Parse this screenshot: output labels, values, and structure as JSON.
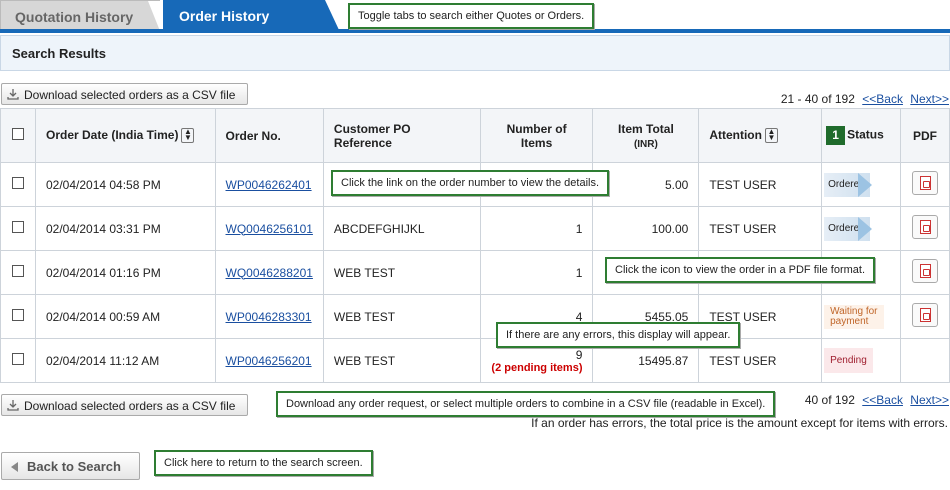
{
  "tabs": {
    "quotation": "Quotation History",
    "order": "Order History"
  },
  "callouts": {
    "tabs": "Toggle tabs to search either Quotes or Orders.",
    "order_link": "Click the link on the order number to view the details.",
    "pdf": "Click the icon to view the order in a PDF file format.",
    "errors": "If there are any errors, this display will appear.",
    "csv": "Download any order request, or select multiple orders to combine in a CSV file (readable in Excel).",
    "back": "Click here to return to the search screen."
  },
  "results_header": "Search Results",
  "csv_button": "Download selected orders as a CSV file",
  "pager": {
    "range": "21 - 40 of 192",
    "back": "<<Back",
    "next": "Next>>",
    "range_bottom": "40 of 192"
  },
  "table": {
    "headers": {
      "order_date": "Order Date (India Time)",
      "order_no": "Order No.",
      "customer_po_1": "Customer PO",
      "customer_po_2": "Reference",
      "items_1": "Number of",
      "items_2": "Items",
      "total_1": "Item Total",
      "total_2": "(INR)",
      "attention": "Attention",
      "status_num": "1",
      "status": "Status",
      "pdf": "PDF"
    },
    "rows": [
      {
        "date": "02/04/2014 04:58 PM",
        "order_no": "WP0046262401",
        "po": "",
        "items": "",
        "total": "5.00",
        "attention": "TEST USER",
        "status": "Ordered"
      },
      {
        "date": "02/04/2014 03:31 PM",
        "order_no": "WQ0046256101",
        "po": "ABCDEFGHIJKL",
        "items": "1",
        "total": "100.00",
        "attention": "TEST USER",
        "status": "Ordered"
      },
      {
        "date": "02/04/2014 01:16 PM",
        "order_no": "WQ0046288201",
        "po": "WEB TEST",
        "items": "1",
        "total": "",
        "attention": "",
        "status": ""
      },
      {
        "date": "02/04/2014 00:59 AM",
        "order_no": "WP0046283301",
        "po": "WEB TEST",
        "items": "4",
        "total": "5455.05",
        "attention": "TEST USER",
        "status_1": "Waiting for",
        "status_2": "payment"
      },
      {
        "date": "02/04/2014 11:12 AM",
        "order_no": "WP0046256201",
        "po": "WEB TEST",
        "items": "9",
        "pending": "(2 pending items)",
        "total": "15495.87",
        "attention": "TEST USER",
        "status": "Pending"
      }
    ]
  },
  "error_note": "If an order has errors, the total price is the amount except for items with errors.",
  "back_button": "Back to Search",
  "colors": {
    "tab_blue": "#1769b8",
    "callout_green": "#2e7d32",
    "link": "#1a4fa0",
    "pending_red": "#cc0000"
  }
}
